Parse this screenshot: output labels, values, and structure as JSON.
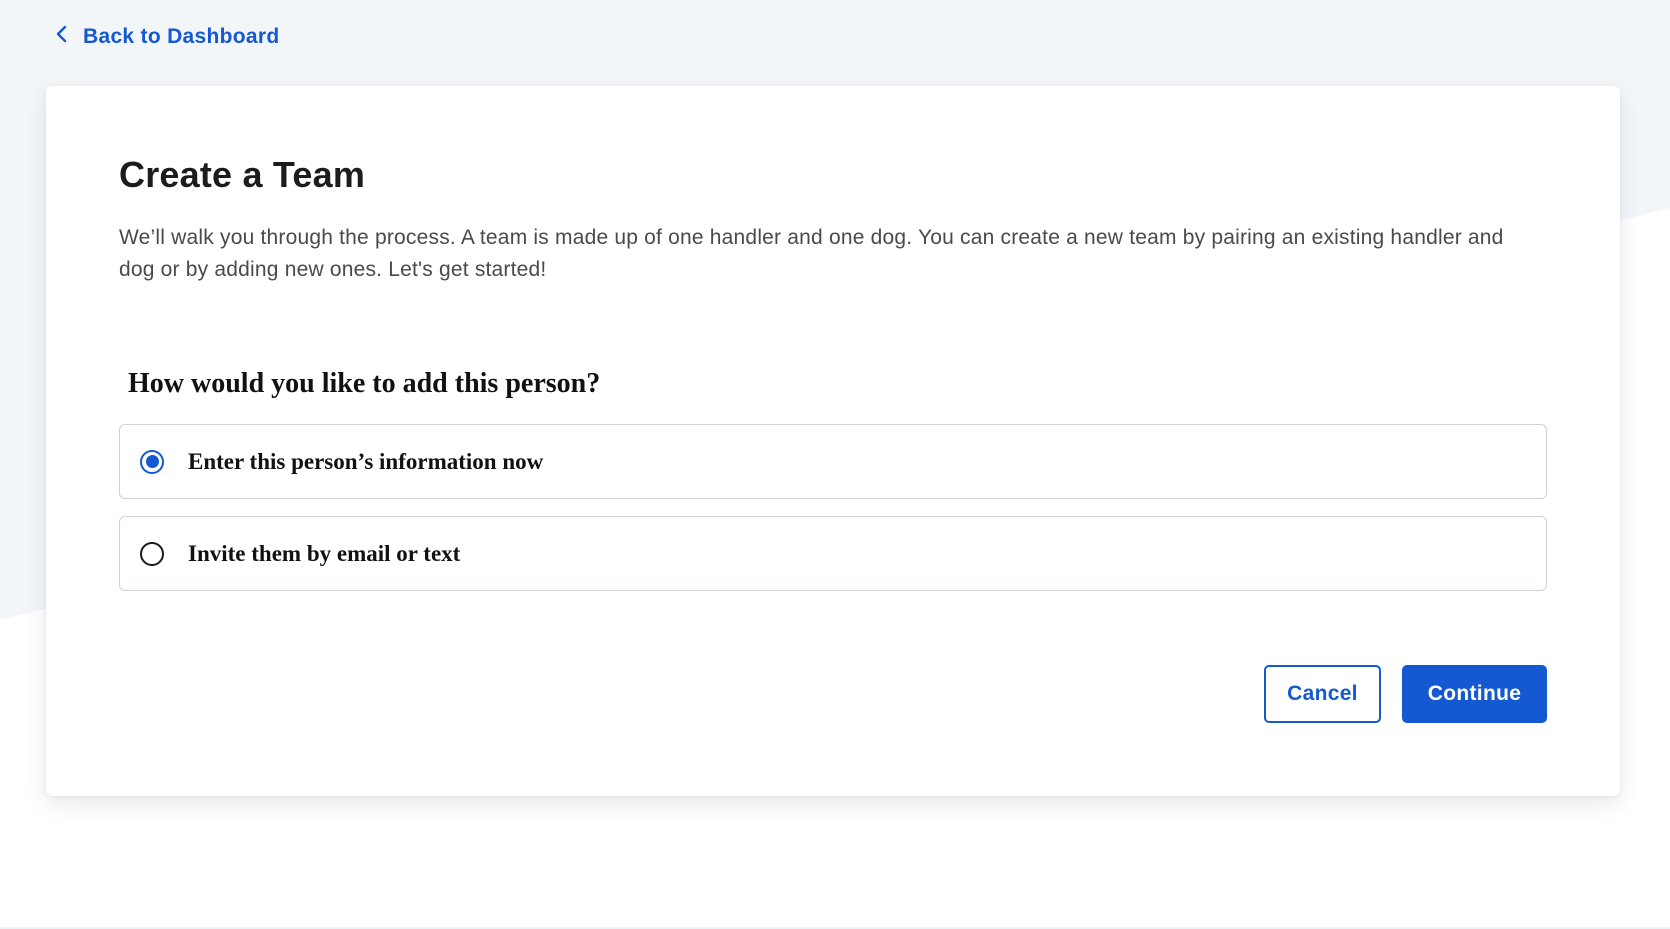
{
  "nav": {
    "back_label": "Back to Dashboard"
  },
  "card": {
    "title": "Create a Team",
    "intro": "We’ll walk you through the process. A team is made up of one handler and one dog. You can create a new team by pairing an existing handler and dog or by adding new ones. Let's get started!",
    "question": "How would you like to add this person?",
    "options": [
      {
        "label": "Enter this person’s information now",
        "selected": true
      },
      {
        "label": "Invite them by email or text",
        "selected": false
      }
    ],
    "cancel_label": "Cancel",
    "continue_label": "Continue"
  },
  "colors": {
    "accent": "#1459d1",
    "background_tint": "#f3f6f9",
    "text": "#1c1c1c",
    "muted_text": "#4a4a4a",
    "border": "#cfd3d8"
  }
}
